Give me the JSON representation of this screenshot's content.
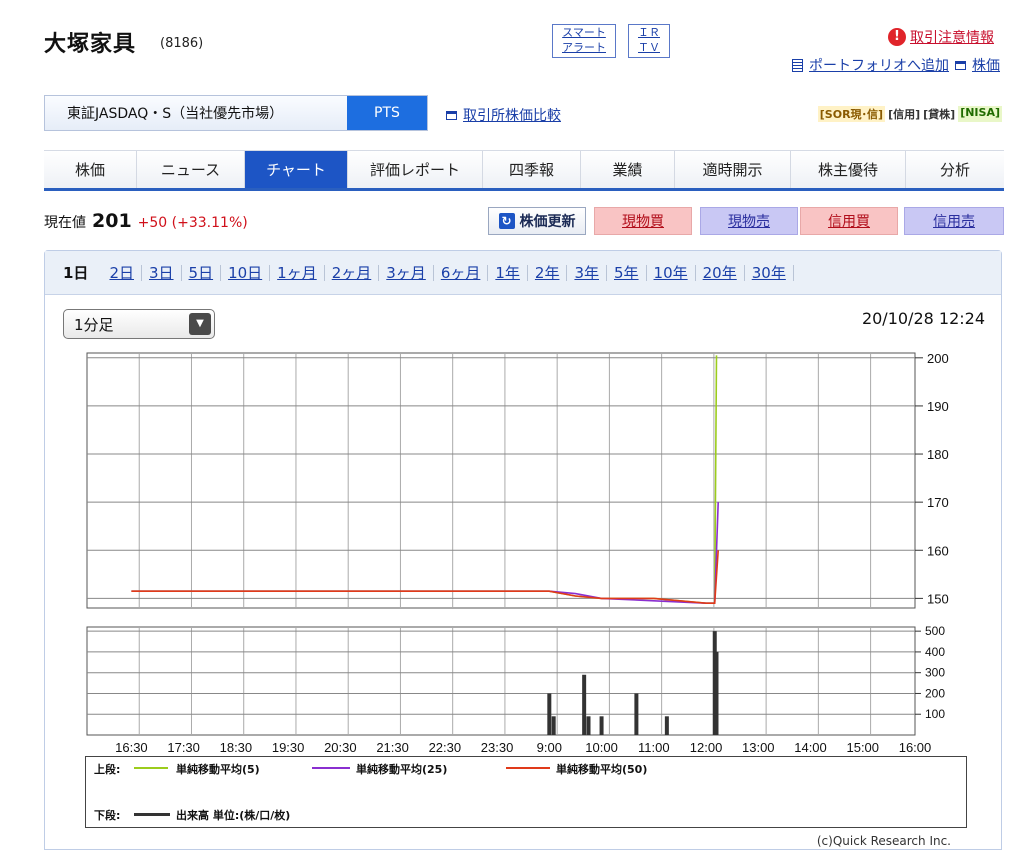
{
  "header": {
    "company": "大塚家具",
    "code": "(8186)",
    "smart_alert_1": "スマート",
    "smart_alert_2": "アラート",
    "ir_1": "ＩＲ",
    "ir_2": "ＴＶ",
    "attention": "取引注意情報",
    "add_portfolio": "ポートフォリオへ追加",
    "stock_price_link": "株価"
  },
  "market": {
    "primary": "東証JASDAQ・S（当社優先市場）",
    "pts": "PTS",
    "compare": "取引所株価比較",
    "badges": [
      "[SOR現･信]",
      "[信用]",
      "[貸株]",
      "[NISA]"
    ]
  },
  "nav": [
    "株価",
    "ニュース",
    "チャート",
    "評価レポート",
    "四季報",
    "業績",
    "適時開示",
    "株主優待",
    "分析"
  ],
  "price": {
    "label": "現在値",
    "value": "201",
    "change": "+50 (+33.11%)",
    "update": "株価更新",
    "buy": "現物買",
    "sell": "現物売",
    "margin_buy": "信用買",
    "margin_sell": "信用売"
  },
  "periods": [
    "1日",
    "2日",
    "3日",
    "5日",
    "10日",
    "1ヶ月",
    "2ヶ月",
    "3ヶ月",
    "6ヶ月",
    "1年",
    "2年",
    "3年",
    "5年",
    "10年",
    "20年",
    "30年"
  ],
  "interval": "1分足",
  "datetime": "20/10/28 12:24",
  "legend": {
    "upper": "上段:",
    "ma5": "単純移動平均(5)",
    "ma25": "単純移動平均(25)",
    "ma50": "単純移動平均(50)",
    "lower": "下段:",
    "volume": "出来高 単位:(株/口/枚)"
  },
  "copyright": "(c)Quick Research Inc.",
  "colors": {
    "ma5": "#9ccc1c",
    "ma25": "#8a2fd0",
    "ma50": "#e03a1a",
    "accent": "#1d55c5"
  },
  "chart_data": [
    {
      "type": "line",
      "title": "",
      "x_ticks": [
        "16:30",
        "17:30",
        "18:30",
        "19:30",
        "20:30",
        "21:30",
        "22:30",
        "23:30",
        "9:00",
        "10:00",
        "11:00",
        "12:00",
        "13:00",
        "14:00",
        "15:00",
        "16:00"
      ],
      "ylim": [
        148,
        201
      ],
      "y_ticks": [
        150,
        160,
        170,
        180,
        190,
        200
      ],
      "series": [
        {
          "name": "単純移動平均(5)",
          "color": "#9ccc1c",
          "points": [
            [
              "16:30",
              151.5
            ],
            [
              "9:00",
              151.5
            ],
            [
              "9:30",
              150.5
            ],
            [
              "10:00",
              150
            ],
            [
              "11:00",
              150
            ],
            [
              "12:00",
              149
            ],
            [
              "12:10",
              149
            ],
            [
              "12:12",
              200.5
            ]
          ]
        },
        {
          "name": "単純移動平均(25)",
          "color": "#8a2fd0",
          "points": [
            [
              "16:30",
              151.5
            ],
            [
              "9:00",
              151.5
            ],
            [
              "9:30",
              151
            ],
            [
              "10:00",
              150
            ],
            [
              "11:00",
              149.5
            ],
            [
              "12:00",
              149
            ],
            [
              "12:10",
              149
            ],
            [
              "12:14",
              170
            ]
          ]
        },
        {
          "name": "単純移動平均(50)",
          "color": "#e03a1a",
          "points": [
            [
              "16:30",
              151.5
            ],
            [
              "9:00",
              151.5
            ],
            [
              "9:30",
              150.5
            ],
            [
              "10:00",
              150
            ],
            [
              "11:00",
              150
            ],
            [
              "12:00",
              149
            ],
            [
              "12:10",
              149
            ],
            [
              "12:14",
              160
            ]
          ]
        }
      ]
    },
    {
      "type": "bar",
      "title": "出来高",
      "ylim": [
        0,
        520
      ],
      "y_ticks": [
        100,
        200,
        300,
        400,
        500
      ],
      "x": [
        "9:00",
        "9:05",
        "9:40",
        "9:45",
        "10:00",
        "10:40",
        "11:15",
        "12:10",
        "12:12"
      ],
      "values": [
        200,
        90,
        290,
        90,
        90,
        200,
        90,
        500,
        400
      ]
    }
  ]
}
